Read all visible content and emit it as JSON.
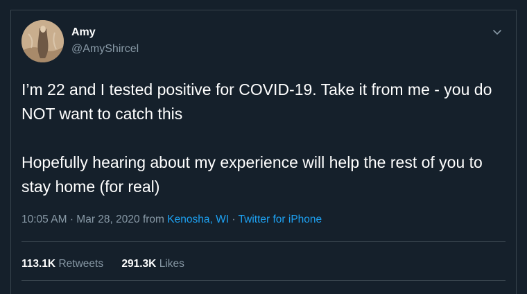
{
  "tweet": {
    "author": {
      "name": "Amy",
      "handle": "@AmyShircel",
      "avatar_icon": "profile-photo"
    },
    "menu_icon": "chevron-down-icon",
    "text": "I’m 22 and I tested positive for COVID-19. Take it from me - you do NOT want to catch this\n\nHopefully hearing about my experience will help the rest of you to stay home (for real)",
    "meta": {
      "time": "10:05 AM",
      "separator": "·",
      "date": "Mar 28, 2020",
      "from_label": "from",
      "location": "Kenosha, WI",
      "source": "Twitter for iPhone"
    },
    "stats": {
      "retweets_count": "113.1K",
      "retweets_label": "Retweets",
      "likes_count": "291.3K",
      "likes_label": "Likes"
    }
  },
  "colors": {
    "background": "#15202b",
    "text": "#ffffff",
    "secondary": "#8899a6",
    "link": "#1da1f2",
    "border": "#38444d"
  }
}
